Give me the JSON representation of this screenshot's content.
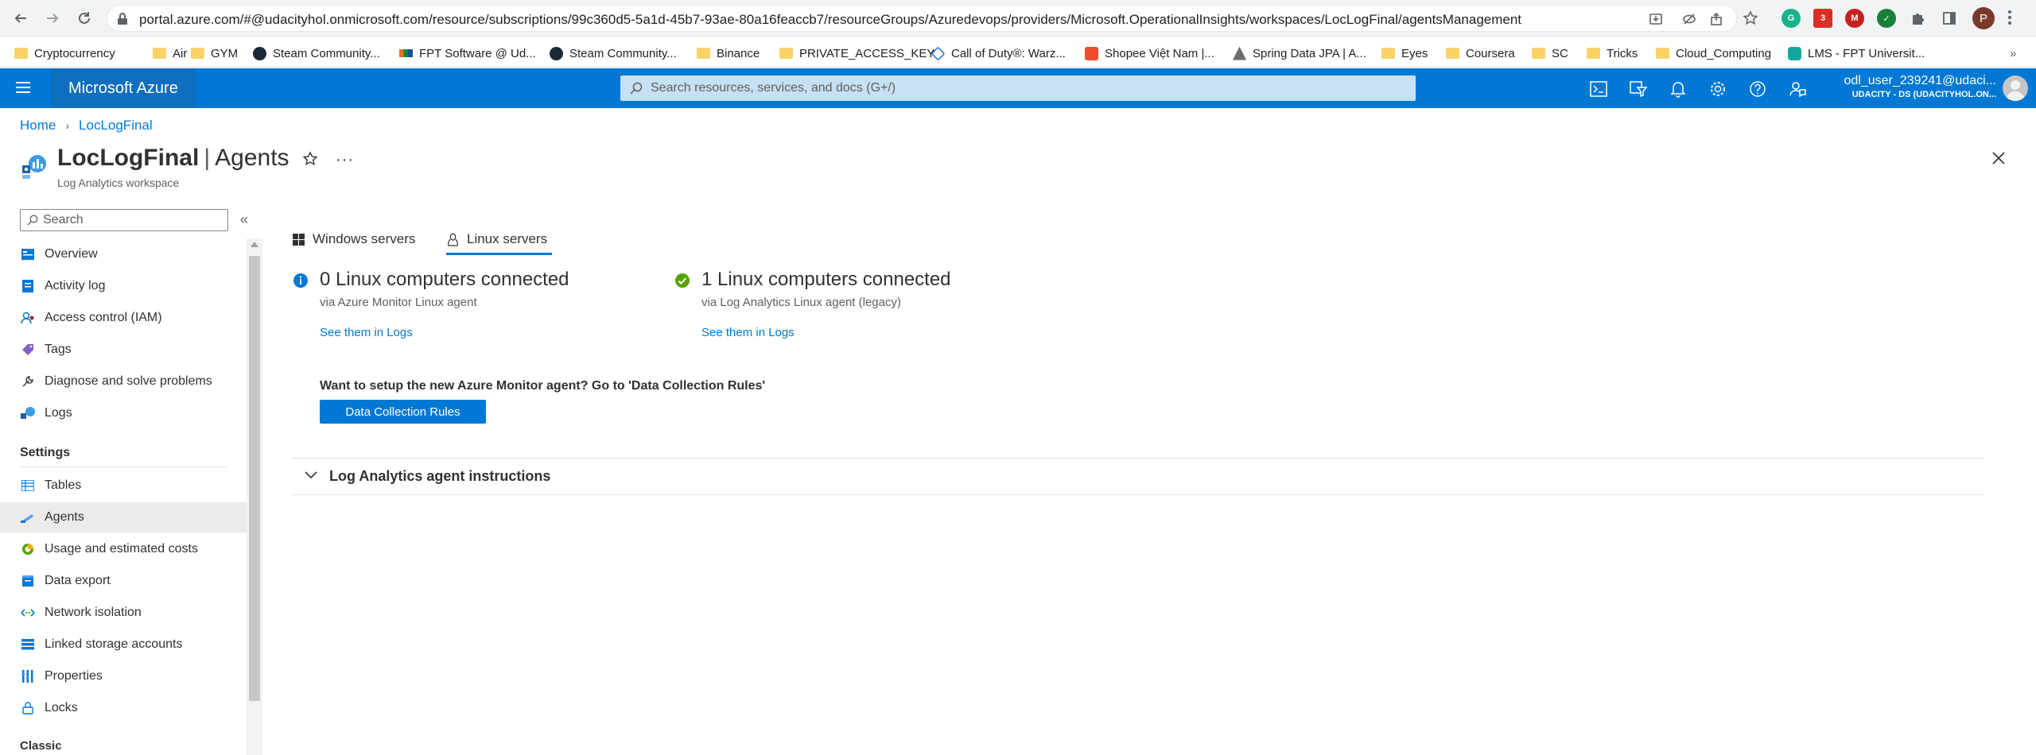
{
  "browser": {
    "url": "portal.azure.com/#@udacityhol.onmicrosoft.com/resource/subscriptions/99c360d5-5a1d-45b7-93ae-80a16feaccb7/resourceGroups/Azuredevops/providers/Microsoft.OperationalInsights/workspaces/LocLogFinal/agentsManagement",
    "profile_initial": "P",
    "extension_badge": "3",
    "bookmarks": [
      {
        "label": "Cryptocurrency",
        "icon": "folder-icon"
      },
      {
        "label": "Air",
        "icon": "folder-icon"
      },
      {
        "label": "GYM",
        "icon": "folder-icon"
      },
      {
        "label": "Steam Community...",
        "icon": "steam-icon"
      },
      {
        "label": "FPT Software @ Ud...",
        "icon": "fpt-icon"
      },
      {
        "label": "Steam Community...",
        "icon": "steam-icon"
      },
      {
        "label": "Binance",
        "icon": "folder-icon"
      },
      {
        "label": "PRIVATE_ACCESS_KEY",
        "icon": "folder-icon"
      },
      {
        "label": "Call of Duty®: Warz...",
        "icon": "cod-icon"
      },
      {
        "label": "Shopee Việt Nam |...",
        "icon": "shopee-icon"
      },
      {
        "label": "Spring Data JPA | A...",
        "icon": "spring-icon"
      },
      {
        "label": "Eyes",
        "icon": "folder-icon"
      },
      {
        "label": "Coursera",
        "icon": "folder-icon"
      },
      {
        "label": "SC",
        "icon": "folder-icon"
      },
      {
        "label": "Tricks",
        "icon": "folder-icon"
      },
      {
        "label": "Cloud_Computing",
        "icon": "folder-icon"
      },
      {
        "label": "LMS - FPT Universit...",
        "icon": "lms-icon"
      }
    ]
  },
  "azure": {
    "brand": "Microsoft Azure",
    "search_placeholder": "Search resources, services, and docs (G+/)",
    "account_name": "odl_user_239241@udaci...",
    "account_tenant": "UDACITY - DS (UDACITYHOL.ON..."
  },
  "header": {
    "breadcrumb": [
      "Home",
      "LocLogFinal"
    ],
    "resource_name": "LocLogFinal",
    "separator": "|",
    "blade_name": "Agents",
    "subtitle": "Log Analytics workspace",
    "more": "···"
  },
  "sidebar": {
    "search_placeholder": "Search",
    "collapse_glyph": "«",
    "items": [
      {
        "label": "Overview",
        "icon": "overview-icon"
      },
      {
        "label": "Activity log",
        "icon": "activity-log-icon"
      },
      {
        "label": "Access control (IAM)",
        "icon": "iam-icon"
      },
      {
        "label": "Tags",
        "icon": "tag-icon"
      },
      {
        "label": "Diagnose and solve problems",
        "icon": "wrench-icon"
      },
      {
        "label": "Logs",
        "icon": "logs-icon"
      }
    ],
    "settings_label": "Settings",
    "settings_items": [
      {
        "label": "Tables",
        "icon": "table-icon"
      },
      {
        "label": "Agents",
        "icon": "agents-icon",
        "selected": true
      },
      {
        "label": "Usage and estimated costs",
        "icon": "usage-icon"
      },
      {
        "label": "Data export",
        "icon": "export-icon"
      },
      {
        "label": "Network isolation",
        "icon": "network-icon"
      },
      {
        "label": "Linked storage accounts",
        "icon": "storage-icon"
      },
      {
        "label": "Properties",
        "icon": "properties-icon"
      },
      {
        "label": "Locks",
        "icon": "lock-icon"
      }
    ],
    "classic_label": "Classic"
  },
  "main": {
    "tabs": [
      {
        "label": "Windows servers",
        "icon": "windows-icon",
        "selected": false
      },
      {
        "label": "Linux servers",
        "icon": "linux-icon",
        "selected": true
      }
    ],
    "stats": [
      {
        "title": "0 Linux computers connected",
        "subtitle": "via Azure Monitor Linux agent",
        "link": "See them in Logs",
        "status": "info"
      },
      {
        "title": "1 Linux computers connected",
        "subtitle": "via Log Analytics Linux agent (legacy)",
        "link": "See them in Logs",
        "status": "success"
      }
    ],
    "dcr_prompt": "Want to setup the new Azure Monitor agent? Go to 'Data Collection Rules'",
    "dcr_button": "Data Collection Rules",
    "accordion_title": "Log Analytics agent instructions"
  },
  "colors": {
    "azure_blue": "#0078d4",
    "success_green": "#57a300",
    "info_blue": "#0078d4"
  }
}
